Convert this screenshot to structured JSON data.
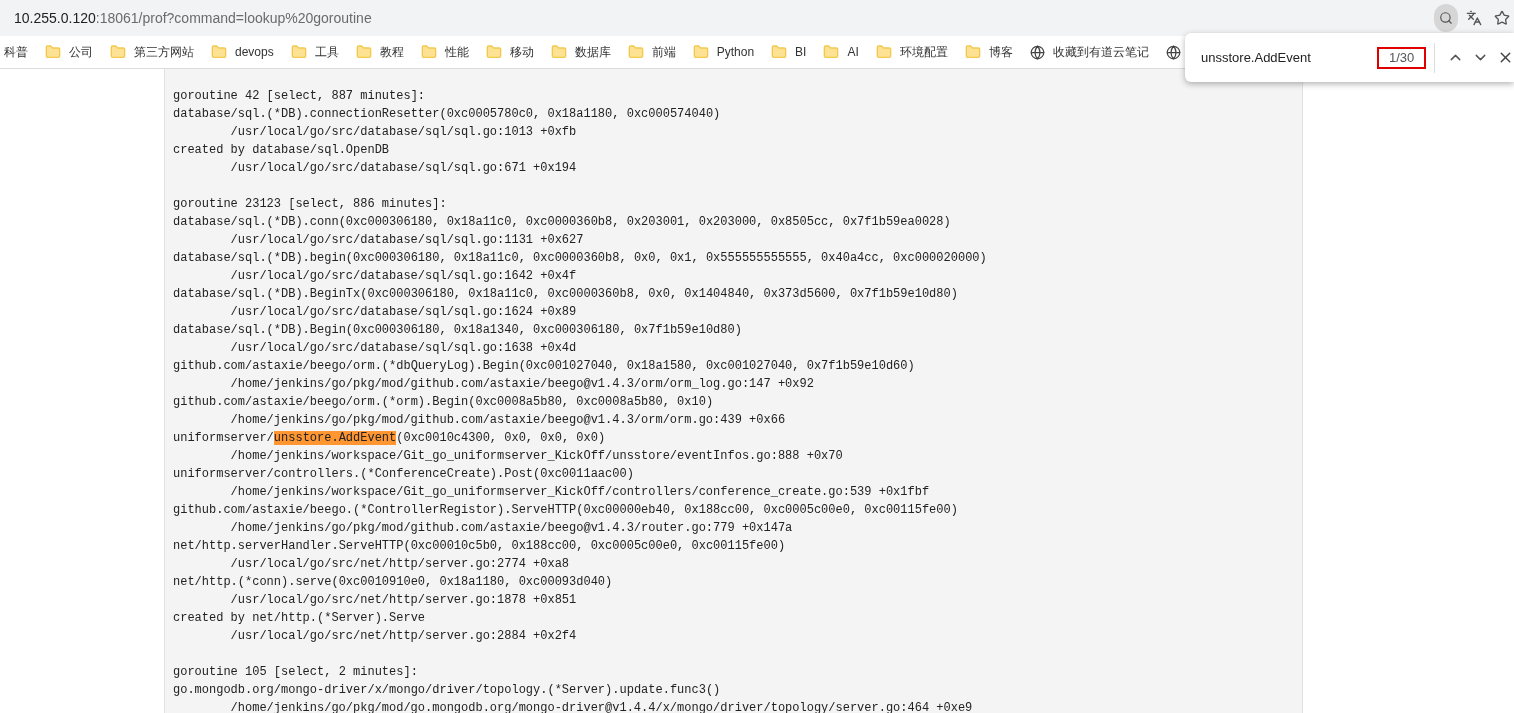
{
  "address_bar": {
    "host": "10.255.0.120",
    "rest": ":18061/prof?command=lookup%20goroutine"
  },
  "toolbar_icons": [
    {
      "kind": "find",
      "selected": true
    },
    {
      "kind": "translate",
      "selected": false
    },
    {
      "kind": "star",
      "selected": false
    }
  ],
  "bookmarks": [
    {
      "label": "科普",
      "kind": "plain"
    },
    {
      "label": "公司",
      "kind": "folder"
    },
    {
      "label": "第三方网站",
      "kind": "folder"
    },
    {
      "label": "devops",
      "kind": "folder"
    },
    {
      "label": "工具",
      "kind": "folder"
    },
    {
      "label": "教程",
      "kind": "folder"
    },
    {
      "label": "性能",
      "kind": "folder"
    },
    {
      "label": "移动",
      "kind": "folder"
    },
    {
      "label": "数据库",
      "kind": "folder"
    },
    {
      "label": "前端",
      "kind": "folder"
    },
    {
      "label": "Python",
      "kind": "folder"
    },
    {
      "label": "BI",
      "kind": "folder"
    },
    {
      "label": "AI",
      "kind": "folder"
    },
    {
      "label": "环境配置",
      "kind": "folder"
    },
    {
      "label": "博客",
      "kind": "folder"
    },
    {
      "label": "收藏到有道云笔记",
      "kind": "globe"
    },
    {
      "kind": "globe"
    }
  ],
  "find_bar": {
    "value": "unsstore.AddEvent",
    "count": "1/30",
    "count_marked": true
  },
  "goroutines": [
    {
      "lines": [
        {
          "text": "goroutine 42 [select, 887 minutes]:",
          "indented": false
        },
        {
          "text": "database/sql.(*DB).connectionResetter(0xc0005780c0, 0x18a1180, 0xc000574040)",
          "indented": false
        },
        {
          "text": "/usr/local/go/src/database/sql/sql.go:1013 +0xfb",
          "indented": true
        },
        {
          "text": "created by database/sql.OpenDB",
          "indented": false
        },
        {
          "text": "/usr/local/go/src/database/sql/sql.go:671 +0x194",
          "indented": true
        }
      ]
    },
    {
      "lines": [
        {
          "text": "goroutine 23123 [select, 886 minutes]:",
          "indented": false
        },
        {
          "text": "database/sql.(*DB).conn(0xc000306180, 0x18a11c0, 0xc0000360b8, 0x203001, 0x203000, 0x8505cc, 0x7f1b59ea0028)",
          "indented": false
        },
        {
          "text": "/usr/local/go/src/database/sql/sql.go:1131 +0x627",
          "indented": true
        },
        {
          "text": "database/sql.(*DB).begin(0xc000306180, 0x18a11c0, 0xc0000360b8, 0x0, 0x1, 0x555555555555, 0x40a4cc, 0xc000020000)",
          "indented": false
        },
        {
          "text": "/usr/local/go/src/database/sql/sql.go:1642 +0x4f",
          "indented": true
        },
        {
          "text": "database/sql.(*DB).BeginTx(0xc000306180, 0x18a11c0, 0xc0000360b8, 0x0, 0x1404840, 0x373d5600, 0x7f1b59e10d80)",
          "indented": false
        },
        {
          "text": "/usr/local/go/src/database/sql/sql.go:1624 +0x89",
          "indented": true
        },
        {
          "text": "database/sql.(*DB).Begin(0xc000306180, 0x18a1340, 0xc000306180, 0x7f1b59e10d80)",
          "indented": false
        },
        {
          "text": "/usr/local/go/src/database/sql/sql.go:1638 +0x4d",
          "indented": true
        },
        {
          "text": "github.com/astaxie/beego/orm.(*dbQueryLog).Begin(0xc001027040, 0x18a1580, 0xc001027040, 0x7f1b59e10d60)",
          "indented": false
        },
        {
          "text": "/home/jenkins/go/pkg/mod/github.com/astaxie/beego@v1.4.3/orm/orm_log.go:147 +0x92",
          "indented": true
        },
        {
          "text": "github.com/astaxie/beego/orm.(*orm).Begin(0xc0008a5b80, 0xc0008a5b80, 0x10)",
          "indented": false
        },
        {
          "text": "/home/jenkins/go/pkg/mod/github.com/astaxie/beego@v1.4.3/orm/orm.go:439 +0x66",
          "indented": true
        },
        {
          "text": "uniformserver/",
          "match": "unsstore.AddEvent",
          "after": "(0xc0010c4300, 0x0, 0x0, 0x0)",
          "indented": false
        },
        {
          "text": "/home/jenkins/workspace/Git_go_uniformserver_KickOff/unsstore/eventInfos.go:888 +0x70",
          "indented": true
        },
        {
          "text": "uniformserver/controllers.(*ConferenceCreate).Post(0xc0011aac00)",
          "indented": false
        },
        {
          "text": "/home/jenkins/workspace/Git_go_uniformserver_KickOff/controllers/conference_create.go:539 +0x1fbf",
          "indented": true
        },
        {
          "text": "github.com/astaxie/beego.(*ControllerRegistor).ServeHTTP(0xc00000eb40, 0x188cc00, 0xc0005c00e0, 0xc00115fe00)",
          "indented": false
        },
        {
          "text": "/home/jenkins/go/pkg/mod/github.com/astaxie/beego@v1.4.3/router.go:779 +0x147a",
          "indented": true
        },
        {
          "text": "net/http.serverHandler.ServeHTTP(0xc00010c5b0, 0x188cc00, 0xc0005c00e0, 0xc00115fe00)",
          "indented": false
        },
        {
          "text": "/usr/local/go/src/net/http/server.go:2774 +0xa8",
          "indented": true
        },
        {
          "text": "net/http.(*conn).serve(0xc0010910e0, 0x18a1180, 0xc00093d040)",
          "indented": false
        },
        {
          "text": "/usr/local/go/src/net/http/server.go:1878 +0x851",
          "indented": true
        },
        {
          "text": "created by net/http.(*Server).Serve",
          "indented": false
        },
        {
          "text": "/usr/local/go/src/net/http/server.go:2884 +0x2f4",
          "indented": true
        }
      ]
    },
    {
      "lines": [
        {
          "text": "goroutine 105 [select, 2 minutes]:",
          "indented": false
        },
        {
          "text": "go.mongodb.org/mongo-driver/x/mongo/driver/topology.(*Server).update.func3()",
          "indented": false
        },
        {
          "text": "/home/jenkins/go/pkg/mod/go.mongodb.org/mongo-driver@v1.4.4/x/mongo/driver/topology/server.go:464 +0xe9",
          "indented": true
        }
      ]
    }
  ]
}
